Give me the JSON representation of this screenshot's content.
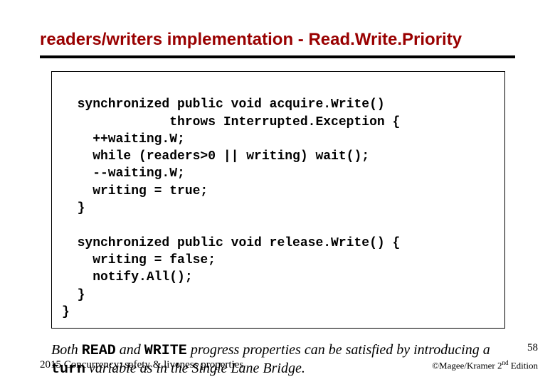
{
  "title": "readers/writers implementation - Read.Write.Priority",
  "code": {
    "block1": "  synchronized public void acquire.Write()\n              throws Interrupted.Exception {\n    ++waiting.W;\n    while (readers>0 || writing) wait();\n    --waiting.W;\n    writing = true;\n  }",
    "block2": "  synchronized public void release.Write() {\n    writing = false;\n    notify.All();\n  }\n}"
  },
  "caption": {
    "pre": "Both ",
    "read": "READ",
    "mid1": " and ",
    "write": "WRITE",
    "mid2": " progress properties can be satisfied by introducing a ",
    "turn": "turn",
    "post": " variable as in the Single Lane Bridge."
  },
  "pagenum": "58",
  "footer_left": "2015  Concurrency: safety & liveness properties",
  "footer_right": {
    "pre": "©Magee/Kramer ",
    "ord": "2",
    "sup": "nd",
    "post": " Edition"
  }
}
